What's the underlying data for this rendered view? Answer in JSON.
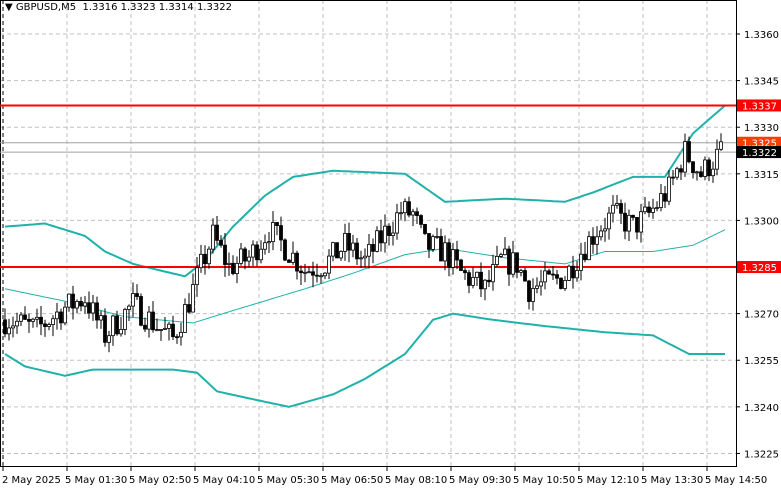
{
  "header": {
    "symbol": "GBPUSD,M5",
    "ohlc": "1.3316 1.3323 1.3314 1.3322"
  },
  "chart_data": {
    "type": "candlestick",
    "title": "GBPUSD,M5",
    "ylim": [
      1.3217,
      1.3371
    ],
    "y_ticks": [
      "1.3360",
      "1.3345",
      "1.3330",
      "1.3315",
      "1.3300",
      "1.3270",
      "1.3255",
      "1.3240",
      "1.3225"
    ],
    "x_tick_labels": [
      "2 May 2025",
      "5 May 01:30",
      "5 May 02:50",
      "5 May 04:10",
      "5 May 05:30",
      "5 May 06:50",
      "5 May 08:10",
      "5 May 09:30",
      "5 May 10:50",
      "5 May 12:10",
      "5 May 13:30",
      "5 May 14:50"
    ],
    "bars_per_tick": 16,
    "bar_count": 180,
    "close_path": [
      [
        1,
        1.3268
      ],
      [
        8,
        1.3265
      ],
      [
        15,
        1.3272
      ],
      [
        20,
        1.3275
      ],
      [
        25,
        1.3263
      ],
      [
        32,
        1.3273
      ],
      [
        38,
        1.3266
      ],
      [
        42,
        1.3262
      ],
      [
        46,
        1.3274
      ],
      [
        49,
        1.3285
      ],
      [
        52,
        1.3295
      ],
      [
        56,
        1.3285
      ],
      [
        61,
        1.3288
      ],
      [
        66,
        1.3297
      ],
      [
        71,
        1.329
      ],
      [
        75,
        1.3284
      ],
      [
        80,
        1.3286
      ],
      [
        85,
        1.3292
      ],
      [
        90,
        1.3287
      ],
      [
        95,
        1.3296
      ],
      [
        99,
        1.3303
      ],
      [
        102,
        1.3302
      ],
      [
        105,
        1.3292
      ],
      [
        110,
        1.329
      ],
      [
        114,
        1.3283
      ],
      [
        120,
        1.3278
      ],
      [
        124,
        1.3287
      ],
      [
        128,
        1.3286
      ],
      [
        131,
        1.3278
      ],
      [
        136,
        1.328
      ],
      [
        140,
        1.3282
      ],
      [
        144,
        1.329
      ],
      [
        148,
        1.3297
      ],
      [
        152,
        1.3302
      ],
      [
        157,
        1.3298
      ],
      [
        161,
        1.3302
      ],
      [
        166,
        1.331
      ],
      [
        170,
        1.3322
      ],
      [
        174,
        1.3315
      ],
      [
        179,
        1.3322
      ]
    ],
    "bollinger_upper": [
      [
        0,
        1.3298
      ],
      [
        10,
        1.3299
      ],
      [
        20,
        1.3295
      ],
      [
        25,
        1.329
      ],
      [
        32,
        1.3286
      ],
      [
        45,
        1.3282
      ],
      [
        50,
        1.3287
      ],
      [
        57,
        1.3298
      ],
      [
        65,
        1.3308
      ],
      [
        72,
        1.3314
      ],
      [
        82,
        1.3316
      ],
      [
        100,
        1.3315
      ],
      [
        110,
        1.3306
      ],
      [
        125,
        1.3307
      ],
      [
        140,
        1.3306
      ],
      [
        147,
        1.3309
      ],
      [
        157,
        1.3314
      ],
      [
        165,
        1.3314
      ],
      [
        172,
        1.3328
      ],
      [
        180,
        1.3337
      ]
    ],
    "bollinger_middle": [
      [
        0,
        1.3278
      ],
      [
        15,
        1.3274
      ],
      [
        30,
        1.3269
      ],
      [
        47,
        1.3267
      ],
      [
        57,
        1.3271
      ],
      [
        75,
        1.3278
      ],
      [
        87,
        1.3283
      ],
      [
        100,
        1.3289
      ],
      [
        110,
        1.3291
      ],
      [
        125,
        1.3288
      ],
      [
        140,
        1.3286
      ],
      [
        150,
        1.329
      ],
      [
        162,
        1.329
      ],
      [
        172,
        1.3292
      ],
      [
        180,
        1.3297
      ]
    ],
    "bollinger_lower": [
      [
        0,
        1.3257
      ],
      [
        5,
        1.3253
      ],
      [
        15,
        1.325
      ],
      [
        22,
        1.3252
      ],
      [
        42,
        1.3252
      ],
      [
        48,
        1.3251
      ],
      [
        53,
        1.3245
      ],
      [
        60,
        1.3243
      ],
      [
        71,
        1.324
      ],
      [
        82,
        1.3244
      ],
      [
        90,
        1.3249
      ],
      [
        100,
        1.3257
      ],
      [
        107,
        1.3268
      ],
      [
        112,
        1.327
      ],
      [
        122,
        1.3268
      ],
      [
        135,
        1.3266
      ],
      [
        150,
        1.3264
      ],
      [
        162,
        1.3263
      ],
      [
        171,
        1.3257
      ],
      [
        180,
        1.3257
      ]
    ],
    "horizontal_levels": [
      {
        "price": "1.3337",
        "color": "#ff0000"
      },
      {
        "price": "1.3285",
        "color": "#ff0000"
      }
    ],
    "price_labels": [
      {
        "price": "1.3337",
        "bg": "#ff0000",
        "fg": "#ffffff"
      },
      {
        "price": "1.3325",
        "bg": "#ff3c00",
        "fg": "#ffffff"
      },
      {
        "price": "1.3322",
        "bg": "#000000",
        "fg": "#ffffff"
      },
      {
        "price": "1.3285",
        "bg": "#ff0000",
        "fg": "#ffffff"
      }
    ],
    "colors": {
      "band": "#20b2aa",
      "level": "#ff0000",
      "grid": "#c0c0c0"
    }
  }
}
